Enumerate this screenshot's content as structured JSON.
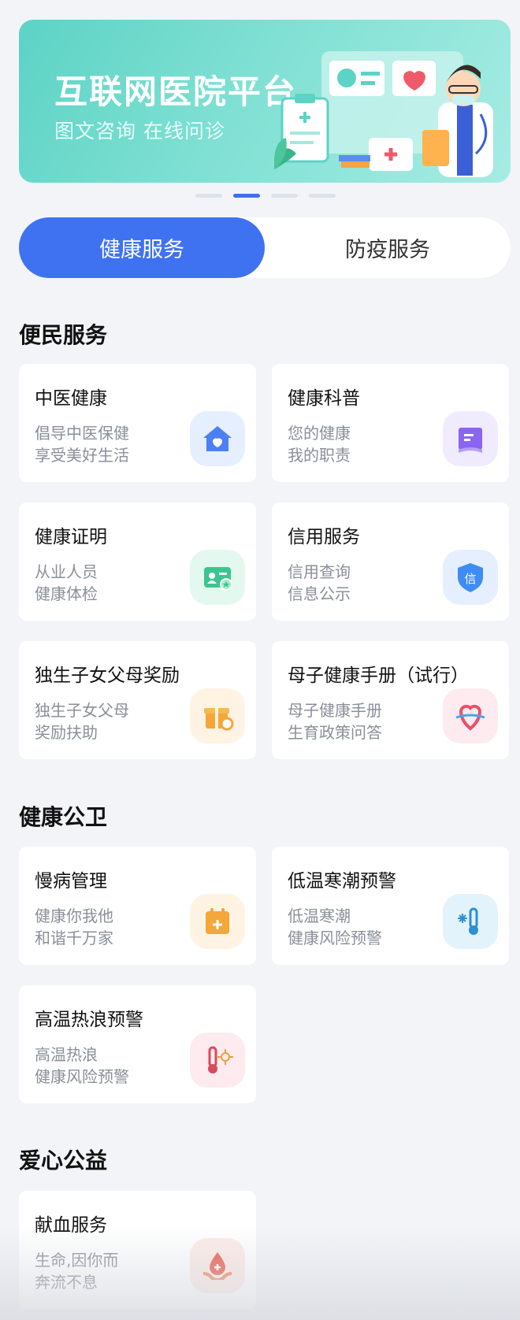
{
  "banner": {
    "title": "互联网医院平台",
    "subtitle": "图文咨询  在线问诊",
    "page_count": 4,
    "active_page": 2
  },
  "tabs": [
    {
      "label": "健康服务",
      "active": true
    },
    {
      "label": "防疫服务",
      "active": false
    }
  ],
  "sections": [
    {
      "title": "便民服务",
      "cards": [
        {
          "title": "中医健康",
          "desc1": "倡导中医保健",
          "desc2": "享受美好生活",
          "icon": "home-heart-icon"
        },
        {
          "title": "健康科普",
          "desc1": "您的健康",
          "desc2": "我的职责",
          "icon": "book-icon"
        },
        {
          "title": "健康证明",
          "desc1": "从业人员",
          "desc2": "健康体检",
          "icon": "id-card-icon"
        },
        {
          "title": "信用服务",
          "desc1": "信用查询",
          "desc2": "信息公示",
          "icon": "credit-shield-icon"
        },
        {
          "title": "独生子女父母奖励",
          "desc1": "独生子女父母",
          "desc2": "奖励扶助",
          "icon": "gift-icon"
        },
        {
          "title": "母子健康手册（试行）",
          "desc1": "母子健康手册",
          "desc2": "生育政策问答",
          "icon": "heart-ribbon-icon"
        }
      ]
    },
    {
      "title": "健康公卫",
      "cards": [
        {
          "title": "慢病管理",
          "desc1": "健康你我他",
          "desc2": "和谐千万家",
          "icon": "calendar-plus-icon"
        },
        {
          "title": "低温寒潮预警",
          "desc1": "低温寒潮",
          "desc2": "健康风险预警",
          "icon": "cold-thermometer-icon"
        },
        {
          "title": "高温热浪预警",
          "desc1": "高温热浪",
          "desc2": "健康风险预警",
          "icon": "hot-thermometer-icon"
        }
      ]
    },
    {
      "title": "爱心公益",
      "cards": [
        {
          "title": "献血服务",
          "desc1": "生命,因你而",
          "desc2": "奔流不息",
          "icon": "blood-drop-hand-icon"
        }
      ]
    }
  ],
  "colors": {
    "accent": "#3f72f1",
    "banner": "#5cd3c5",
    "background": "#f2f4f8"
  }
}
